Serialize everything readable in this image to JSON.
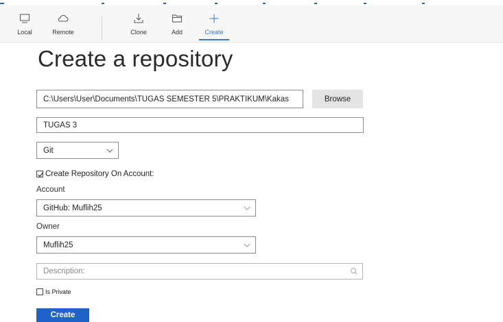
{
  "toolbar": {
    "items": [
      {
        "label": "Local",
        "icon": "monitor-icon"
      },
      {
        "label": "Remote",
        "icon": "cloud-icon"
      },
      {
        "label": "Clone",
        "icon": "download-tray-icon"
      },
      {
        "label": "Add",
        "icon": "folder-icon"
      },
      {
        "label": "Create",
        "icon": "plus-icon"
      }
    ],
    "active": "Create"
  },
  "page": {
    "title": "Create a repository"
  },
  "form": {
    "path_value": "C:\\Users\\User\\Documents\\TUGAS SEMESTER 5\\PRAKTIKUM\\Kakas",
    "browse_label": "Browse",
    "name_value": "TUGAS 3",
    "vcs_selected": "Git",
    "create_on_account_label": "Create Repository On Account:",
    "create_on_account_checked": true,
    "account_label": "Account",
    "account_selected": "GitHub: Muflih25",
    "owner_label": "Owner",
    "owner_selected": "Muflih25",
    "description_placeholder": "Description:",
    "is_private_label": "Is Private",
    "is_private_checked": false,
    "create_label": "Create"
  },
  "colors": {
    "accent": "#2f7ad3",
    "primary_button": "#1f62c9"
  }
}
